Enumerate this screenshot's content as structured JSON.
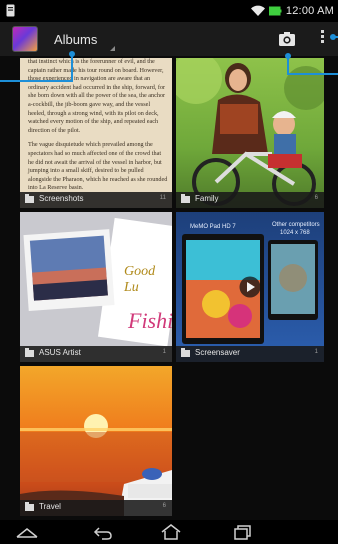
{
  "status_bar": {
    "time": "12:00 AM",
    "icons": [
      "notification-icon",
      "wifi-icon",
      "battery-icon"
    ],
    "battery_color": "#3fcf3f"
  },
  "action_bar": {
    "title": "Albums",
    "icons": [
      "gallery-app-icon",
      "camera-icon",
      "overflow-menu-icon"
    ]
  },
  "albums": [
    {
      "name": "Screenshots",
      "count": "11",
      "preview_text": [
        "that instinct which is the forerunner of evil, and the captain rather made his tour round on board. However, those experienced in navigation are aware that an ordinary accident had occurred in the ship, forward, for she born down with all the power of the sea, the anchor a-cockbill, the jib-boom gave way, and the vessel heeled, through a strong wind, with its pilot on deck, watched every motion of the ship, and repeated each direction of the pilot.",
        "The vague disquietude which prevailed among the spectators had so much affected one of the crowd that he did not await the arrival of the vessel in harbor, but jumping into a small skiff, desired to be pulled alongside the Pharaon, which he reached as she rounded into La Reserve basin."
      ]
    },
    {
      "name": "Family",
      "count": "6"
    },
    {
      "name": "ASUS Artist",
      "count": "1",
      "card_text": [
        "Good Lu",
        "Fishi"
      ]
    },
    {
      "name": "Screensaver",
      "count": "1",
      "preview_labels": [
        "MeMO Pad HD 7",
        "Other competitors",
        "1024 x 768"
      ]
    },
    {
      "name": "Travel",
      "count": "6"
    }
  ],
  "navigation_bar": {
    "buttons": [
      "recent-apps-icon",
      "back-icon",
      "home-icon",
      "recents-icon"
    ]
  },
  "accent_color": "#1d8fd8"
}
